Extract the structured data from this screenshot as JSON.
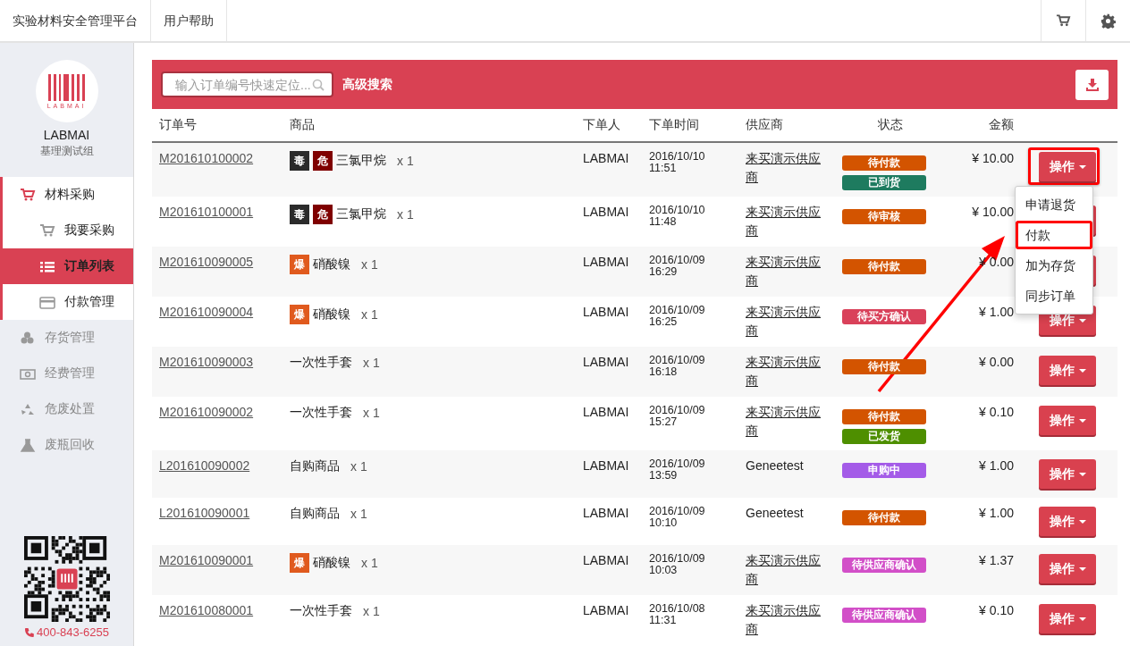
{
  "top_bar": {
    "title": "实验材料安全管理平台",
    "links": [
      "用户帮助"
    ]
  },
  "sidebar": {
    "logo_text": "LABMAI",
    "org": "LABMAI",
    "group": "基理测试组",
    "phone": "400-843-6255",
    "items": [
      {
        "label": "材料采购",
        "selected": false,
        "expanded": true,
        "children": [
          {
            "label": "我要采购",
            "selected": false
          },
          {
            "label": "订单列表",
            "selected": true
          },
          {
            "label": "付款管理",
            "selected": false
          }
        ]
      },
      {
        "label": "存货管理",
        "selected": false,
        "expanded": false
      },
      {
        "label": "经费管理",
        "selected": false,
        "expanded": false
      },
      {
        "label": "危废处置",
        "selected": false,
        "expanded": false
      },
      {
        "label": "废瓶回收",
        "selected": false,
        "expanded": false
      }
    ]
  },
  "toolbar": {
    "search": {
      "placeholder": "输入订单编号快速定位..."
    },
    "advanced_link": "高级搜索"
  },
  "table": {
    "columns": [
      "订单号",
      "商品",
      "下单人",
      "下单时间",
      "供应商",
      "状态",
      "金额"
    ],
    "rows": [
      {
        "order": "M201610100002",
        "tags": [
          {
            "label": "毒",
            "color": "#2b2b2b"
          },
          {
            "label": "危",
            "color": "#7f0000"
          }
        ],
        "product": "三氯甲烷",
        "qty": "x 1",
        "buyer": "LABMAI",
        "time": "2016/10/10 11:51",
        "supplier": "来买演示供应商",
        "link": true,
        "statuses": [
          {
            "label": "待付款",
            "color": "#d35400"
          },
          {
            "label": "已到货",
            "color": "#1e7b5f"
          }
        ],
        "amount": "¥ 10.00",
        "action": "操作",
        "highlighted": true,
        "menu": [
          {
            "label": "申请退货",
            "highlighted": false
          },
          {
            "label": "付款",
            "highlighted": true
          },
          {
            "label": "加为存货",
            "highlighted": false
          },
          {
            "label": "同步订单",
            "highlighted": false
          }
        ]
      },
      {
        "order": "M201610100001",
        "tags": [
          {
            "label": "毒",
            "color": "#2b2b2b"
          },
          {
            "label": "危",
            "color": "#7f0000"
          }
        ],
        "product": "三氯甲烷",
        "qty": "x 1",
        "buyer": "LABMAI",
        "time": "2016/10/10 11:48",
        "supplier": "来买演示供应商",
        "link": true,
        "statuses": [
          {
            "label": "待审核",
            "color": "#d35400"
          }
        ],
        "amount": "¥ 10.00",
        "highlighted": false
      },
      {
        "order": "M201610090005",
        "tags": [
          {
            "label": "爆",
            "color": "#e05a1e"
          }
        ],
        "product": "硝酸镍",
        "qty": "x 1",
        "buyer": "LABMAI",
        "time": "2016/10/09 16:29",
        "supplier": "来买演示供应商",
        "link": true,
        "statuses": [
          {
            "label": "待付款",
            "color": "#d35400"
          }
        ],
        "amount": "¥ 0.00",
        "highlighted": false
      },
      {
        "order": "M201610090004",
        "tags": [
          {
            "label": "爆",
            "color": "#e05a1e"
          }
        ],
        "product": "硝酸镍",
        "qty": "x 1",
        "buyer": "LABMAI",
        "time": "2016/10/09 16:25",
        "supplier": "来买演示供应商",
        "link": true,
        "statuses": [
          {
            "label": "待买方确认",
            "color": "#d9415a"
          }
        ],
        "amount": "¥ 1.00",
        "action": "操作",
        "highlighted": false
      },
      {
        "order": "M201610090003",
        "tags": [],
        "product": "一次性手套",
        "qty": "x 1",
        "buyer": "LABMAI",
        "time": "2016/10/09 16:18",
        "supplier": "来买演示供应商",
        "link": true,
        "statuses": [
          {
            "label": "待付款",
            "color": "#d35400"
          }
        ],
        "amount": "¥ 0.00",
        "action": "操作",
        "highlighted": false
      },
      {
        "order": "M201610090002",
        "tags": [],
        "product": "一次性手套",
        "qty": "x 1",
        "buyer": "LABMAI",
        "time": "2016/10/09 15:27",
        "supplier": "来买演示供应商",
        "link": true,
        "statuses": [
          {
            "label": "待付款",
            "color": "#d35400"
          },
          {
            "label": "已发货",
            "color": "#4e8f00"
          }
        ],
        "amount": "¥ 0.10",
        "action": "操作",
        "highlighted": false
      },
      {
        "order": "L201610090002",
        "tags": [],
        "product": "自购商品",
        "qty": "x 1",
        "buyer": "LABMAI",
        "time": "2016/10/09 13:59",
        "supplier": "Geneetest",
        "link": false,
        "statuses": [
          {
            "label": "申购中",
            "color": "#a45be8"
          }
        ],
        "amount": "¥ 1.00",
        "action": "操作",
        "highlighted": false
      },
      {
        "order": "L201610090001",
        "tags": [],
        "product": "自购商品",
        "qty": "x 1",
        "buyer": "LABMAI",
        "time": "2016/10/09 10:10",
        "supplier": "Geneetest",
        "link": false,
        "statuses": [
          {
            "label": "待付款",
            "color": "#d35400"
          }
        ],
        "amount": "¥ 1.00",
        "action": "操作",
        "highlighted": false
      },
      {
        "order": "M201610090001",
        "tags": [
          {
            "label": "爆",
            "color": "#e05a1e"
          }
        ],
        "product": "硝酸镍",
        "qty": "x 1",
        "buyer": "LABMAI",
        "time": "2016/10/09 10:03",
        "supplier": "来买演示供应商",
        "link": true,
        "statuses": [
          {
            "label": "待供应商确认",
            "color": "#d24fc8"
          }
        ],
        "amount": "¥ 1.37",
        "action": "操作",
        "highlighted": false
      },
      {
        "order": "M201610080001",
        "tags": [],
        "product": "一次性手套",
        "qty": "x 1",
        "buyer": "LABMAI",
        "time": "2016/10/08 11:31",
        "supplier": "来买演示供应商",
        "link": true,
        "statuses": [
          {
            "label": "待供应商确认",
            "color": "#d24fc8"
          }
        ],
        "amount": "¥ 0.10",
        "action": "操作",
        "highlighted": false
      }
    ]
  }
}
